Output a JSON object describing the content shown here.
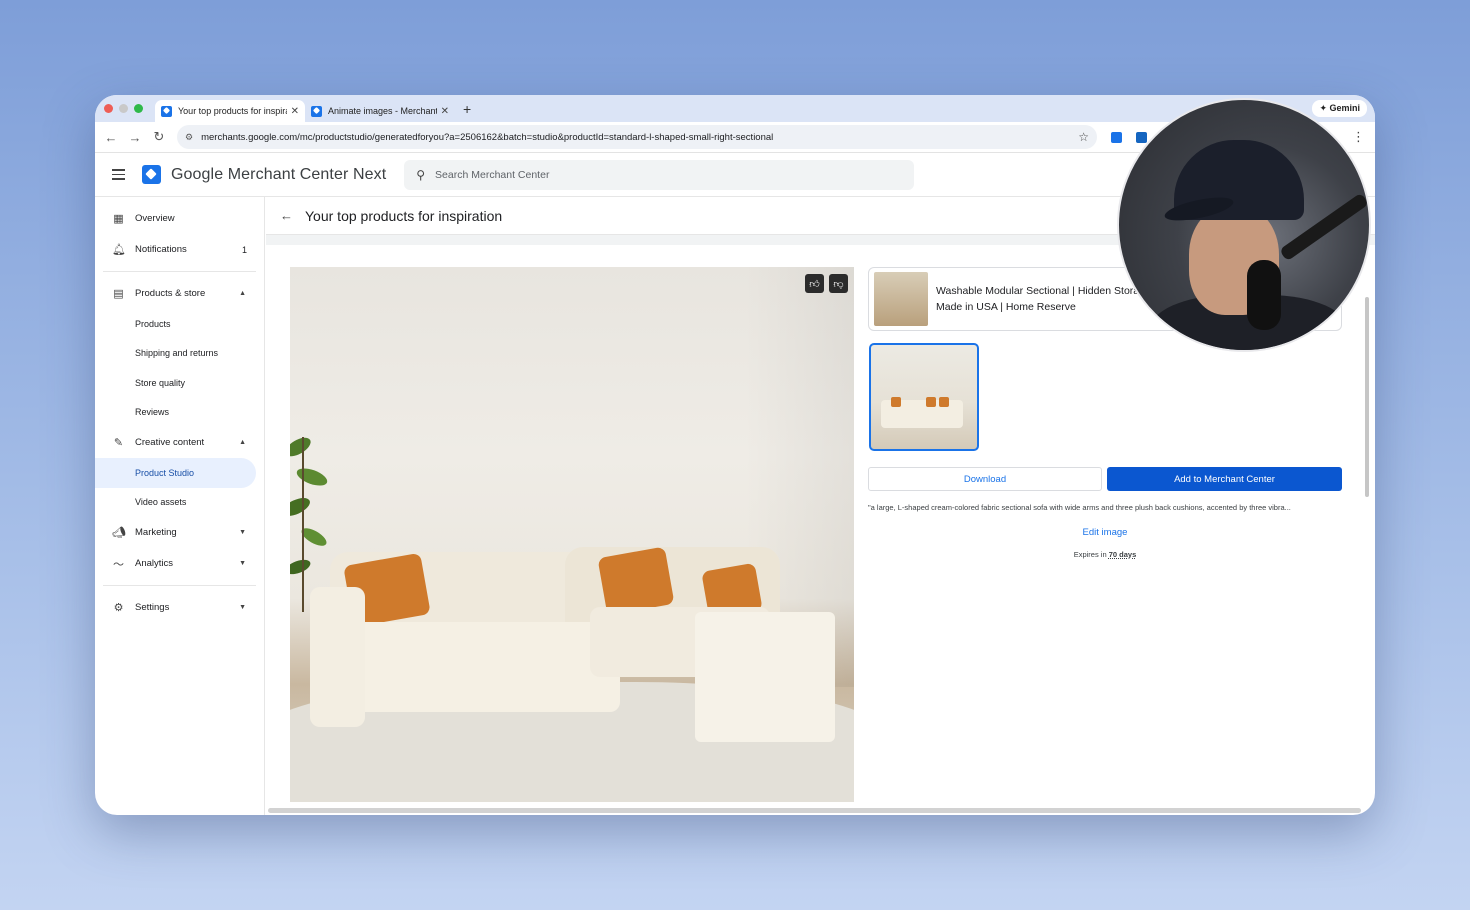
{
  "browser": {
    "tabs": [
      {
        "title": "Your top products for inspirat",
        "active": true
      },
      {
        "title": "Animate images - Merchant C",
        "active": false
      }
    ],
    "new_tab": "+",
    "gemini_label": "Gemini",
    "url": "merchants.google.com/mc/productstudio/generatedforyou?a=2506162&batch=studio&productId=standard-l-shaped-small-right-sectional"
  },
  "app": {
    "brand": "Google Merchant Center Next",
    "search_placeholder": "Search Merchant Center"
  },
  "sidebar": {
    "overview": "Overview",
    "notifications": "Notifications",
    "notifications_count": "1",
    "products_store": "Products & store",
    "products": "Products",
    "shipping": "Shipping and returns",
    "store_quality": "Store quality",
    "reviews": "Reviews",
    "creative_content": "Creative content",
    "product_studio": "Product Studio",
    "video_assets": "Video assets",
    "marketing": "Marketing",
    "analytics": "Analytics",
    "settings": "Settings"
  },
  "page": {
    "title": "Your top products for inspiration",
    "product_title": "Washable Modular Sectional | Hidden Stora | Made in USA | Home Reserve",
    "download_label": "Download",
    "add_label": "Add to Merchant Center",
    "description": "\"a large, L-shaped cream-colored fabric sectional sofa with wide arms and three plush back cushions, accented by three vibra...",
    "edit_label": "Edit image",
    "expires_prefix": "Expires in",
    "expires_value": "70 days"
  },
  "colors": {
    "accent": "#1a73e8",
    "primary_button": "#0b57d0",
    "selected_nav": "#e8f0fe"
  }
}
